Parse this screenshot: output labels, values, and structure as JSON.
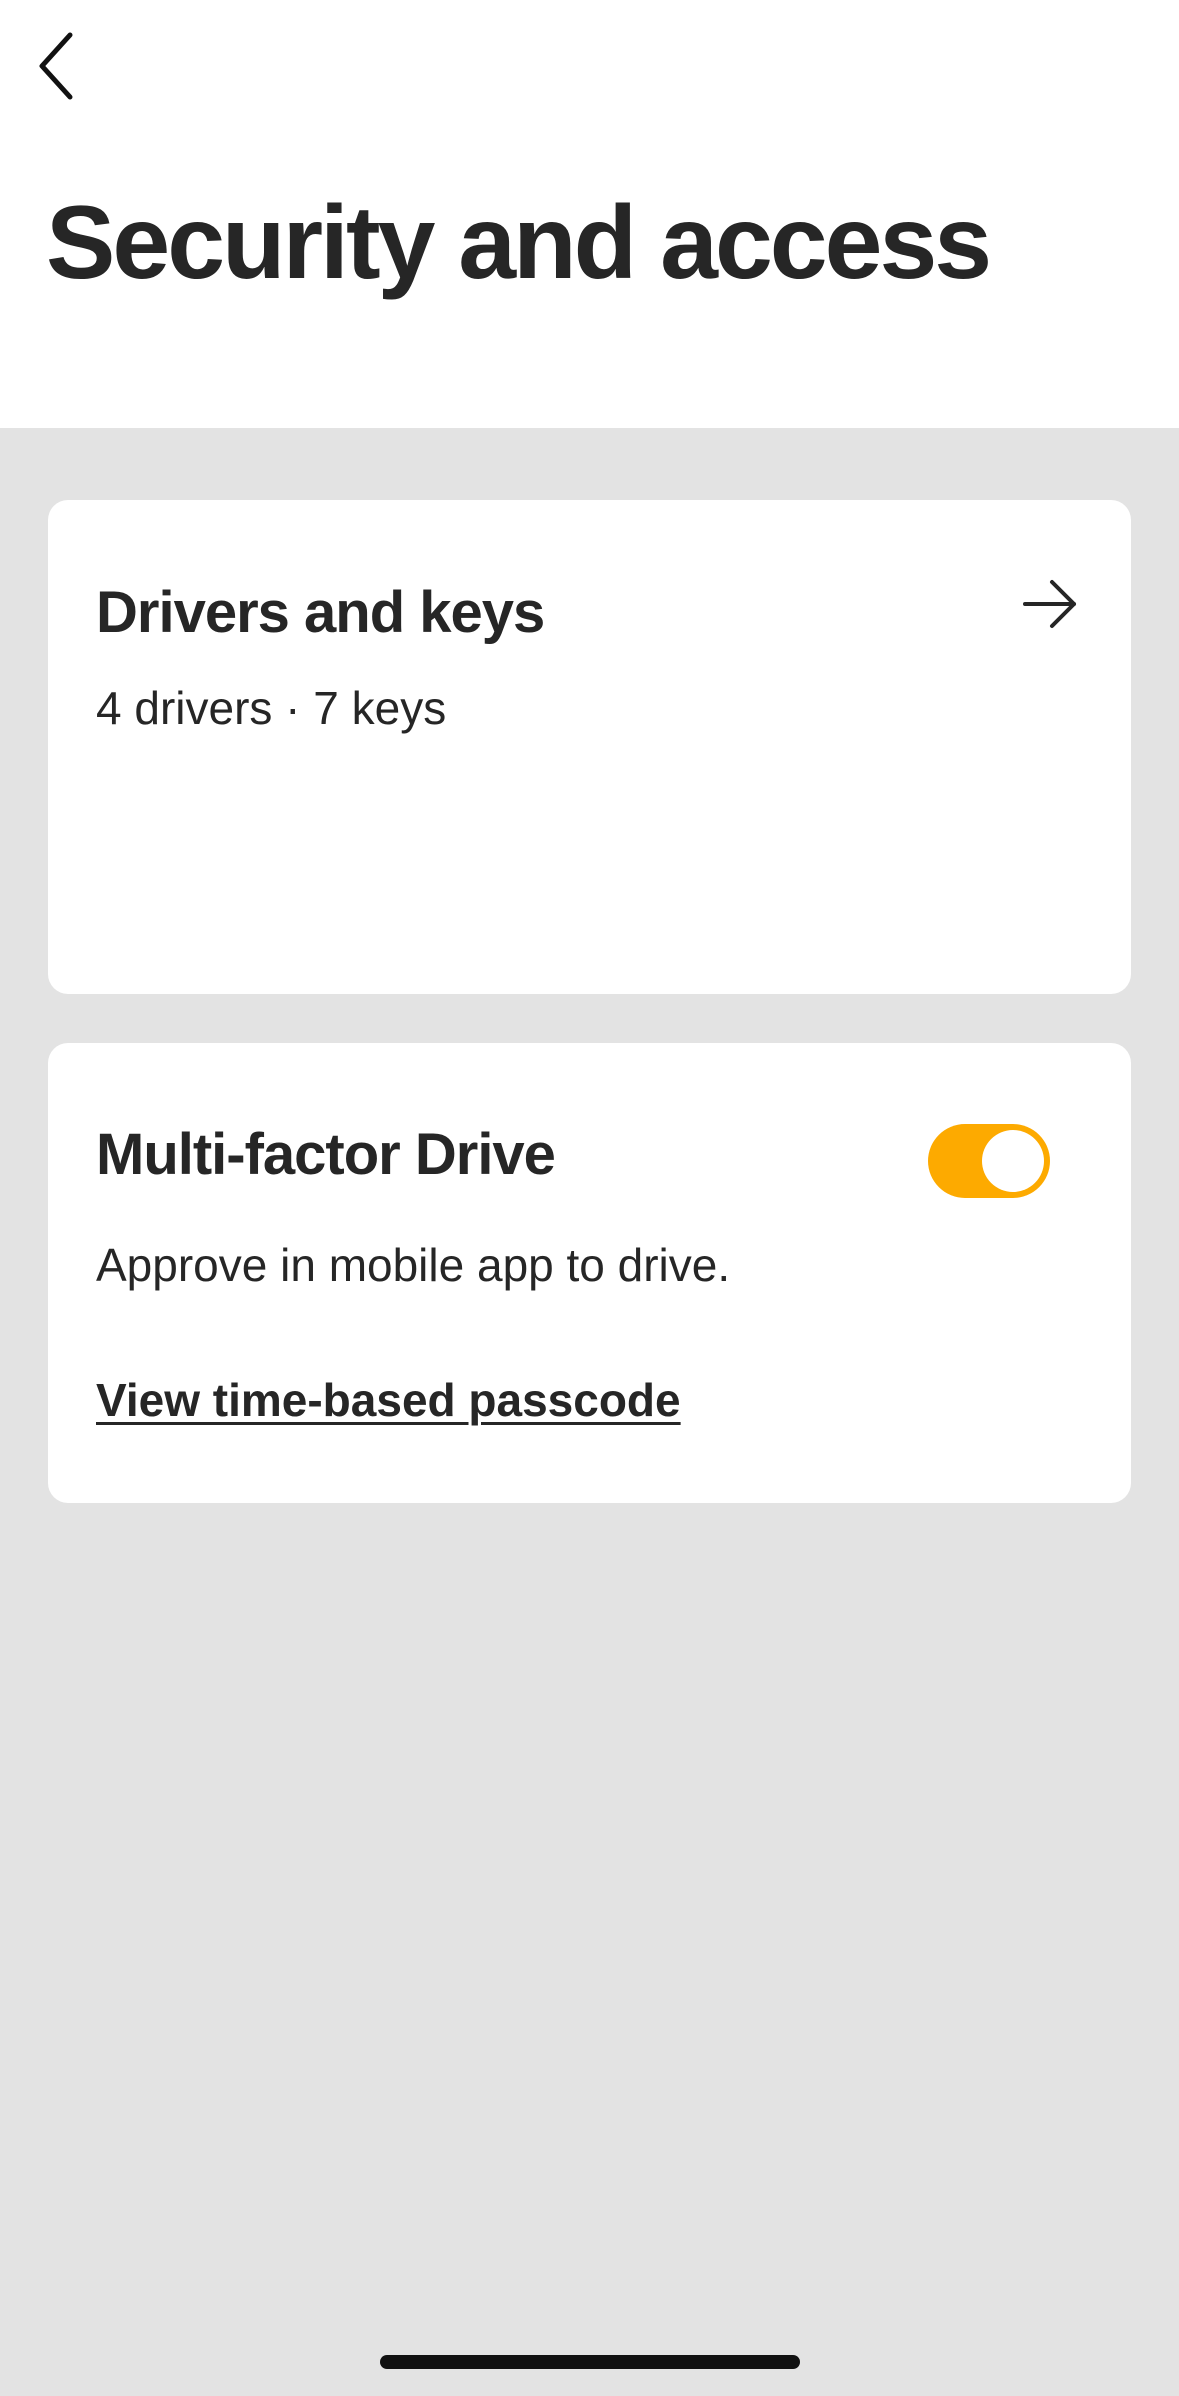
{
  "header": {
    "back_icon": "chevron-left-icon",
    "title": "Security and access"
  },
  "drivers_card": {
    "title": "Drivers and keys",
    "subtitle": "4 drivers · 7 keys",
    "arrow_icon": "arrow-right-icon"
  },
  "mfa_card": {
    "title": "Multi-factor Drive",
    "description": "Approve in mobile app to drive.",
    "toggle_on": true,
    "toggle_color": "#fdaa00",
    "link_label": "View time-based passcode"
  },
  "colors": {
    "background": "#e3e3e3",
    "card": "#ffffff",
    "text": "#262626",
    "accent": "#fdaa00"
  }
}
